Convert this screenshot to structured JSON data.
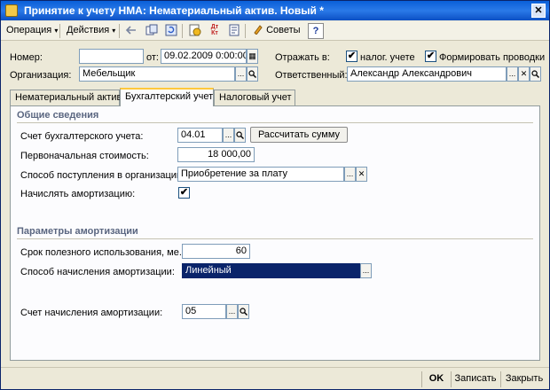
{
  "window": {
    "title": "Принятие к учету НМА: Нематериальный актив. Новый *",
    "close_glyph": "✕"
  },
  "toolbar": {
    "operation_label": "Операция",
    "actions_label": "Действия",
    "advice_label": "Советы",
    "help_label": "?",
    "caret": "▾",
    "dtkt_label": "Дт Кт",
    "icons": [
      "arrow-left-icon",
      "copy-icon",
      "refresh-icon",
      "post-document-icon",
      "dtkt-icon",
      "report-icon",
      "advice-icon"
    ]
  },
  "header": {
    "number_label": "Номер:",
    "number_value": "",
    "date_label": "от:",
    "date_value": "09.02.2009  0:00:00",
    "reflect_label": "Отражать в:",
    "tax_accounting_label": "налог. учете",
    "tax_accounting_checked": true,
    "form_entries_label": "Формировать проводки",
    "form_entries_checked": true,
    "organization_label": "Организация:",
    "organization_value": "Мебельщик",
    "responsible_label": "Ответственный:",
    "responsible_value": "Александр Александрович"
  },
  "tabs": [
    {
      "label": "Нематериальный актив",
      "active": false
    },
    {
      "label": "Бухгалтерский учет",
      "active": true
    },
    {
      "label": "Налоговый учет",
      "active": false
    }
  ],
  "general": {
    "section_title": "Общие сведения",
    "account_label": "Счет бухгалтерского учета:",
    "account_value": "04.01",
    "calc_button": "Рассчитать сумму",
    "initial_cost_label": "Первоначальная стоимость:",
    "initial_cost_value": "18 000,00",
    "receipt_method_label": "Способ поступления в организацию:",
    "receipt_method_value": "Приобретение за плату",
    "amortize_label": "Начислять амортизацию:",
    "amortize_checked": true
  },
  "amortization": {
    "section_title": "Параметры амортизации",
    "useful_life_label": "Срок полезного использования, ме...",
    "useful_life_value": "60",
    "method_label": "Способ начисления амортизации:",
    "method_value": "Линейный",
    "account_label": "Счет начисления амортизации:",
    "account_value": "05"
  },
  "footer": {
    "ok_label": "OK",
    "save_label": "Записать",
    "close_label": "Закрыть"
  },
  "glyphs": {
    "ellipsis": "...",
    "search": "🔍",
    "clear": "✕",
    "calendar": "▦",
    "check": "✔"
  }
}
